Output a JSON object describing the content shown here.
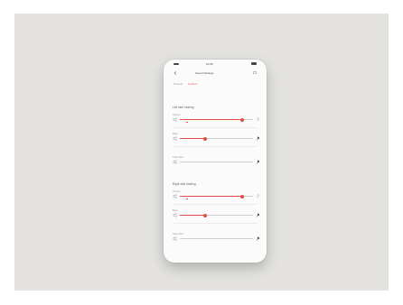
{
  "screen": {
    "status": {
      "time": "10:45"
    },
    "header": {
      "title": "Sound Settings"
    },
    "tabs": [
      {
        "label": "Presets"
      },
      {
        "label": "Custom"
      }
    ],
    "sections": [
      {
        "title": "Left side hearing",
        "sliders": [
          {
            "label": "Volume",
            "level": 0.85,
            "right_icon": "ear-icon"
          },
          {
            "label": "Bass",
            "level": 0.35,
            "right_icon": "pin-icon"
          },
          {
            "label": "Noise filter",
            "level": 0.0,
            "right_icon": "pin-icon"
          }
        ]
      },
      {
        "title": "Right side hearing",
        "sliders": [
          {
            "label": "Volume",
            "level": 0.85,
            "right_icon": "ear-icon"
          },
          {
            "label": "Bass",
            "level": 0.35,
            "right_icon": "pin-icon"
          },
          {
            "label": "Noise filter",
            "level": 0.0,
            "right_icon": "pin-icon"
          }
        ]
      }
    ]
  },
  "colors": {
    "accent": "#e24e44",
    "background": "#e3e2de",
    "screen": "#fbfbfb"
  }
}
